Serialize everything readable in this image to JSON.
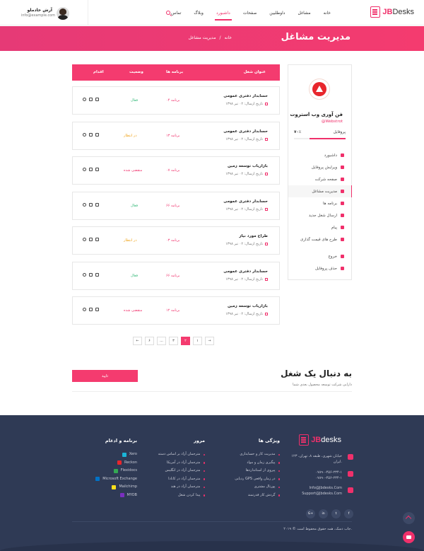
{
  "header": {
    "logo_part1": "JB",
    "logo_part2": "Desks",
    "nav": [
      "خانه",
      "مشاغل",
      "داوطلبین",
      "صفحات",
      "داشبورد",
      "وبلاگ",
      "تماس"
    ],
    "active_nav": "داشبورد",
    "user_name": "آرش خادملو",
    "user_email": "info@example.com"
  },
  "banner": {
    "title": "مدیریت مشاغل",
    "crumb_home": "خانه",
    "crumb_sep": "/",
    "crumb_current": "مدیریت مشاغل"
  },
  "sidebar": {
    "company_name": "فن آوری وب استروت",
    "company_user": "@Webstrot",
    "profile_label": "پروفایل",
    "profile_value": "۷۰٪",
    "profile_fraction": 0.7,
    "menu": [
      {
        "label": "داشبورد",
        "icon": "dashboard-icon",
        "active": false
      },
      {
        "label": "ویرایش پروفایل",
        "icon": "edit-icon",
        "active": false
      },
      {
        "label": "صفحه شرکت",
        "icon": "file-icon",
        "active": false
      },
      {
        "label": "مدیریت مشاغل",
        "icon": "briefcase-icon",
        "active": true
      },
      {
        "label": "برنامه ها",
        "icon": "document-icon",
        "active": false
      },
      {
        "label": "ارسال شغل جدید",
        "icon": "user-plus-icon",
        "active": false
      },
      {
        "label": "پیام",
        "icon": "mail-icon",
        "active": false
      },
      {
        "label": "طرح های قیمت گذاری",
        "icon": "tag-icon",
        "active": false
      }
    ],
    "menu2": [
      {
        "label": "خروج",
        "icon": "power-icon"
      },
      {
        "label": "حذف پروفایل",
        "icon": "trash-icon"
      }
    ]
  },
  "table": {
    "headers": {
      "title": "عنوان شغل",
      "apps": "برنامه ها",
      "status": "وضعیت",
      "action": "اقدام"
    },
    "rows": [
      {
        "title": "حسابدار دفتری عمومی",
        "date": "تاریخ ارسال: ۰۲ تیر ۱۳۹۸",
        "apps": "۰۴ برنامه",
        "status": "فعال",
        "status_color": "#2bb673"
      },
      {
        "title": "حسابدار دفتری عمومی",
        "date": "تاریخ ارسال: ۰۲ تیر ۱۳۹۸",
        "apps": "۱۳ برنامه",
        "status": "در انتظار",
        "status_color": "#f0a51f"
      },
      {
        "title": "بازاریاب توسعه زمین",
        "date": "تاریخ ارسال: ۰۲ تیر ۱۳۹۸",
        "apps": "۰۷ برنامه",
        "status": "منقضی شده",
        "status_color": "#f0306b"
      },
      {
        "title": "حسابدار دفتری عمومی",
        "date": "تاریخ ارسال: ۰۲ تیر ۱۳۹۸",
        "apps": "۶۶ برنامه",
        "status": "فعال",
        "status_color": "#2bb673"
      },
      {
        "title": "طراح مورد نیاز",
        "date": "تاریخ ارسال: ۰۲ تیر ۱۳۹۸",
        "apps": "۰۳ برنامه",
        "status": "در انتظار",
        "status_color": "#f0a51f"
      },
      {
        "title": "حسابدار دفتری عمومی",
        "date": "تاریخ ارسال: ۰۲ تیر ۱۳۹۸",
        "apps": "۶۶ برنامه",
        "status": "فعال",
        "status_color": "#2bb673"
      },
      {
        "title": "بازاریاب توسعه زمین",
        "date": "تاریخ ارسال: ۰۲ تیر ۱۳۹۸",
        "apps": "۱۲ برنامه",
        "status": "منقضی شده",
        "status_color": "#f0306b"
      }
    ]
  },
  "pagination": [
    "←",
    "۶",
    "...",
    "۳",
    "۲",
    "۱",
    "→"
  ],
  "pagination_active": "۲",
  "follow": {
    "title": "به دنبال یک شغل",
    "subtitle": "دارایی شرکت توسعه محصول بعدی شما",
    "button": "تایید"
  },
  "footer": {
    "logo_part1": "JB",
    "logo_part2": "desks",
    "address": "۱۲۳ خیابان شهری، طبقه ۸، تهران، ایران.",
    "phone1": "۰۷۸۹۰-۴۵۶-۲۳۴-۱",
    "phone2": "۰۷۸۹۰-۴۵۶-۲۳۴-۱",
    "email1": "Info@Jbdesks.Com",
    "email2": "Support@Jbdesks.Com",
    "social": [
      "f",
      "t",
      "in",
      "G+"
    ],
    "col1_title": "ویژگی ها",
    "col1": [
      "مدیریت کار و حسابداری",
      "پیگیری زمان و مواد",
      "پیروی از استانداردها",
      "ردیابی GPS در زمان واقعی",
      "پورتال مشتری",
      "گردش کار قدرتمند"
    ],
    "col2_title": "مرور",
    "col2": [
      "مترجمان آزاد بر اساس دسته",
      "مترجمان آزاد در آمریکا",
      "مترجمان آزاد در انگلیس",
      "مترجمان آزاد در کانادا",
      "مترجمان آزاد در هند",
      "پیدا کردن شغل"
    ],
    "col3_title": "برنامه و ادغام",
    "col3": [
      {
        "label": "Xero",
        "color": "#1ab4d7"
      },
      {
        "label": "Reckon",
        "color": "#e8262c"
      },
      {
        "label": "Flexidocs",
        "color": "#34a853"
      },
      {
        "label": "Microsoft Exchange",
        "color": "#0072c6"
      },
      {
        "label": "Mailchimp",
        "color": "#ffe01b"
      },
      {
        "label": "MYOB",
        "color": "#7b2fbf"
      }
    ],
    "copyright": "۲۰۱۹ © جاب دسک، همه حقوق محفوظ است."
  }
}
